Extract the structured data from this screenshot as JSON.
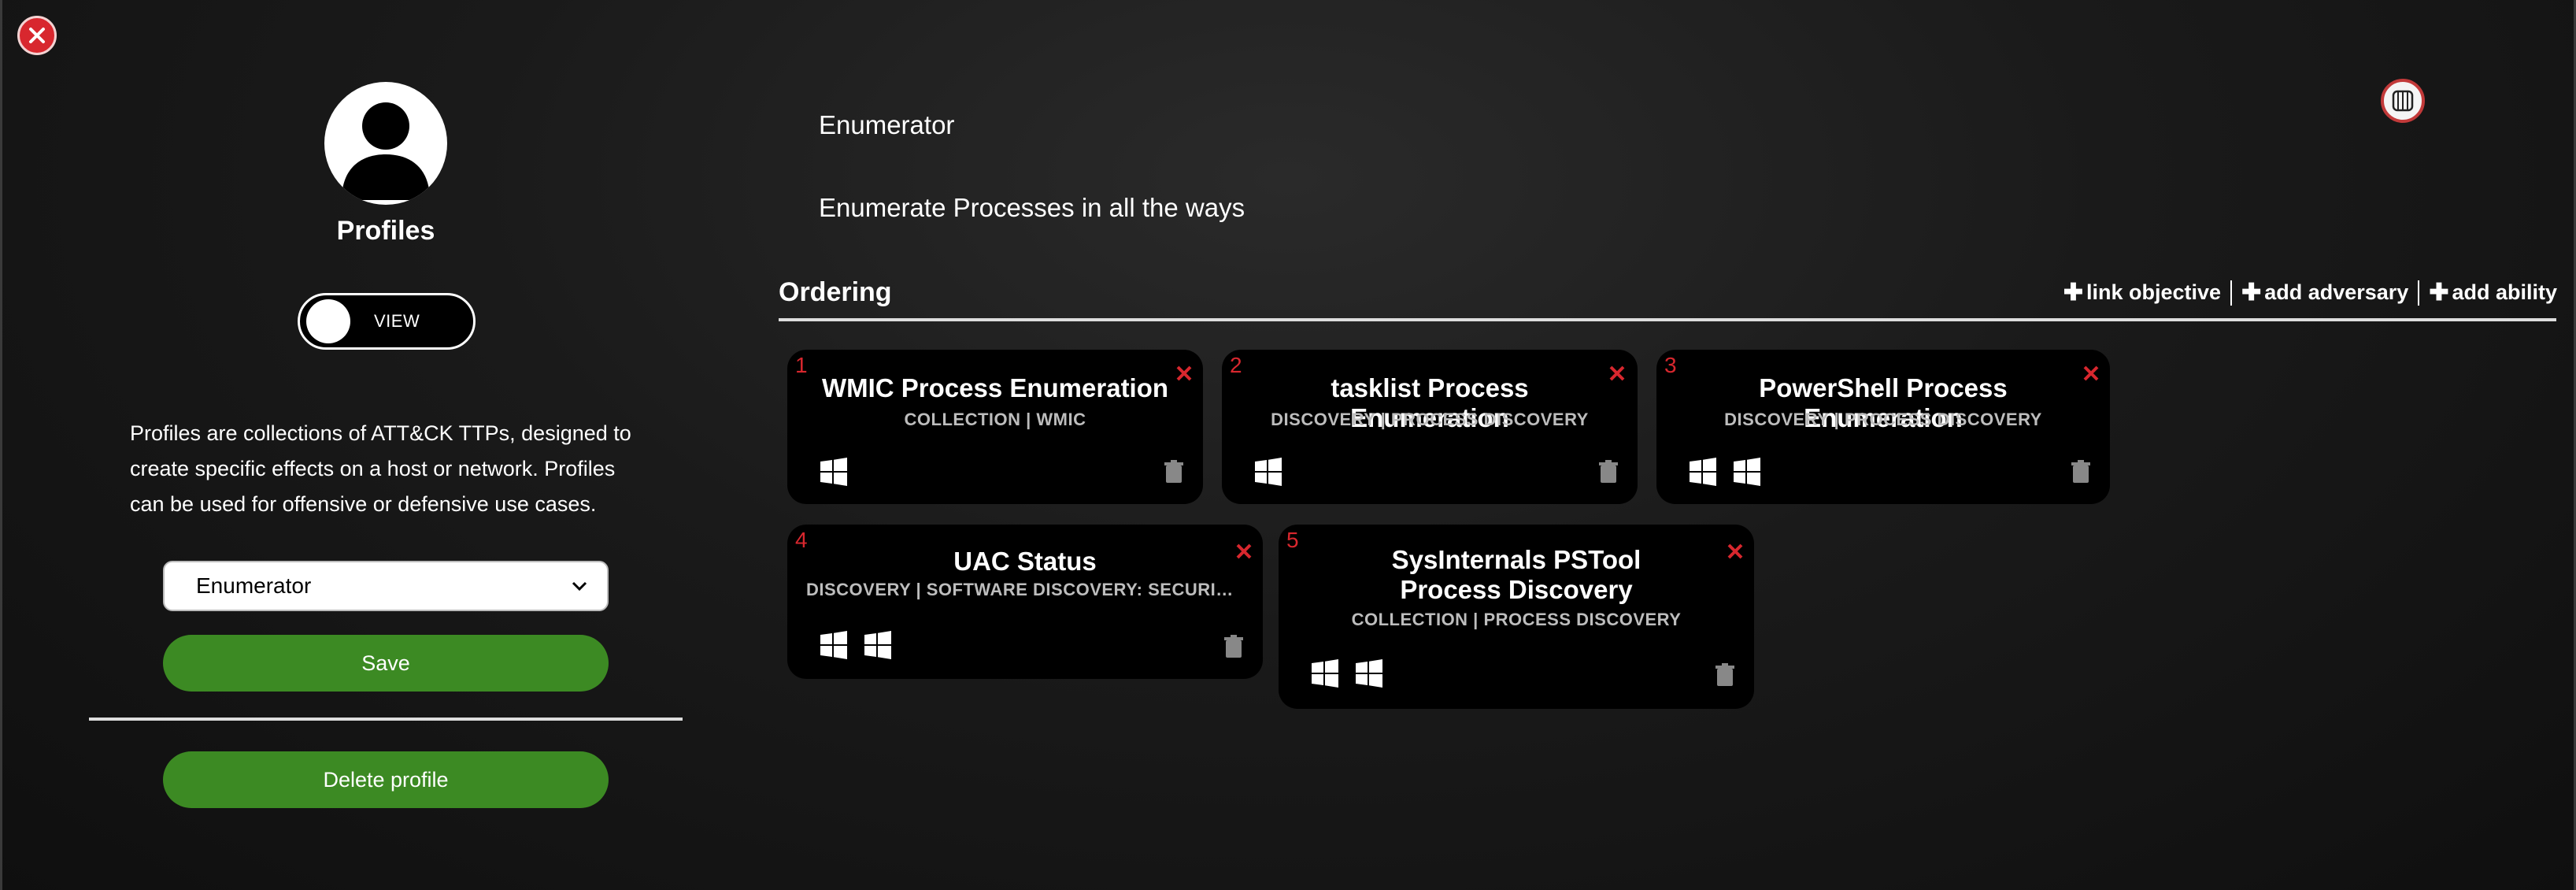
{
  "window": {
    "close_icon": "close-icon"
  },
  "sidebar": {
    "avatar_icon": "user-silhouette-icon",
    "title": "Profiles",
    "toggle_label": "VIEW",
    "description": "Profiles are collections of ATT&CK TTPs, designed to create specific effects on a host or network. Profiles can be used for offensive or defensive use cases.",
    "select_value": "Enumerator",
    "save_label": "Save",
    "delete_label": "Delete profile"
  },
  "main": {
    "profile_name": "Enumerator",
    "profile_description": "Enumerate Processes in all the ways",
    "ordering_title": "Ordering",
    "actions": [
      {
        "label": "link objective",
        "icon": "plus-icon"
      },
      {
        "label": "add adversary",
        "icon": "plus-icon"
      },
      {
        "label": "add ability",
        "icon": "plus-icon"
      }
    ]
  },
  "abilities": [
    {
      "number": "1",
      "title": "WMIC Process Enumeration",
      "subtitle": "COLLECTION | WMIC",
      "platforms": [
        "windows"
      ]
    },
    {
      "number": "2",
      "title": "tasklist Process Enumeration",
      "subtitle": "DISCOVERY | PROCESS DISCOVERY",
      "platforms": [
        "windows"
      ]
    },
    {
      "number": "3",
      "title": "PowerShell Process Enumeration",
      "subtitle": "DISCOVERY | PROCESS DISCOVERY",
      "platforms": [
        "windows",
        "windows"
      ]
    },
    {
      "number": "4",
      "title": "UAC Status",
      "subtitle": "DISCOVERY | SOFTWARE DISCOVERY: SECURITY SOFTWARE DISCOVERY",
      "platforms": [
        "windows",
        "windows"
      ]
    },
    {
      "number": "5",
      "title": "SysInternals PSTool Process Discovery",
      "subtitle": "COLLECTION | PROCESS DISCOVERY",
      "platforms": [
        "windows",
        "windows"
      ]
    }
  ],
  "colors": {
    "accent_red": "#d8272e",
    "button_green": "#3c8a23",
    "card_bg": "#000000"
  }
}
